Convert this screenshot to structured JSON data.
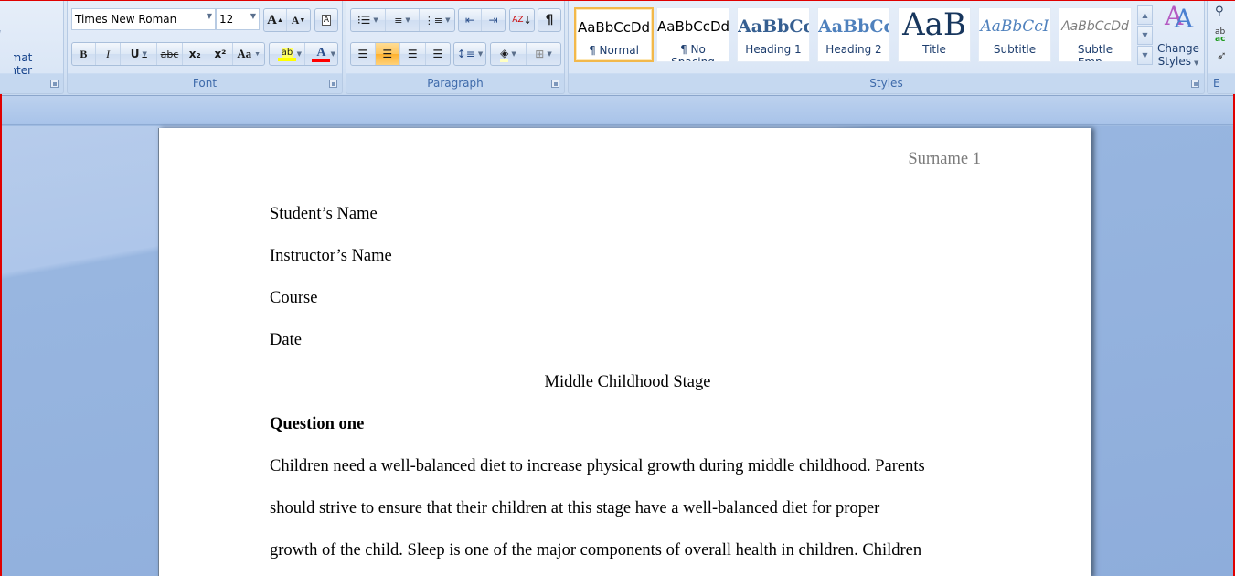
{
  "ribbon": {
    "clipboard": {
      "format_painter_label": "Format Painter"
    },
    "font": {
      "label": "Font",
      "font_name": "Times New Roman",
      "font_size": "12",
      "grow_font": "A",
      "shrink_font": "A",
      "clear_formatting": "A",
      "bold": "B",
      "italic": "I",
      "underline": "U",
      "strikethrough": "abc",
      "subscript": "x₂",
      "superscript": "x²",
      "change_case": "Aa",
      "highlight": "ab",
      "font_color": "A",
      "highlight_color": "#ffff00",
      "font_color_value": "#ff0000"
    },
    "paragraph": {
      "label": "Paragraph",
      "pilcrow": "¶",
      "active_alignment": "center"
    },
    "styles": {
      "label": "Styles",
      "items": [
        {
          "sample": "AaBbCcDd",
          "name": "¶ Normal",
          "selected": true
        },
        {
          "sample": "AaBbCcDd",
          "name": "¶ No Spacing",
          "selected": false
        },
        {
          "sample": "AaBbCc",
          "name": "Heading 1",
          "selected": false
        },
        {
          "sample": "AaBbCc",
          "name": "Heading 2",
          "selected": false
        },
        {
          "sample": "AaB",
          "name": "Title",
          "selected": false
        },
        {
          "sample": "AaBbCcI",
          "name": "Subtitle",
          "selected": false
        },
        {
          "sample": "AaBbCcDd",
          "name": "Subtle Emp...",
          "selected": false
        }
      ],
      "change_styles_line1": "Change",
      "change_styles_line2": "Styles"
    },
    "editing": {
      "label": "E"
    }
  },
  "document": {
    "header": "Surname 1",
    "lines": [
      "Student’s Name",
      "Instructor’s Name",
      "Course",
      "Date"
    ],
    "title": "Middle Childhood Stage",
    "heading": "Question one",
    "body": [
      "Children need a well-balanced diet to increase physical growth during middle childhood. Parents",
      "should strive to ensure that their children at this stage have a well-balanced diet for proper",
      "growth of the child. Sleep is one of the major components of overall health in children. Children"
    ]
  }
}
